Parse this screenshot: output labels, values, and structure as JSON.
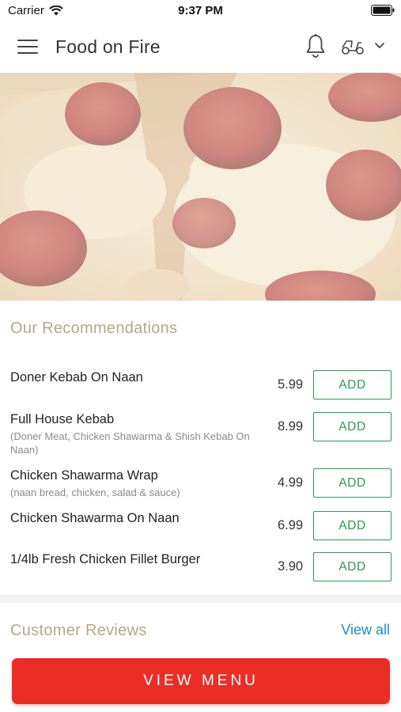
{
  "status_bar": {
    "carrier": "Carrier",
    "time": "9:37 PM"
  },
  "header": {
    "title": "Food on Fire"
  },
  "recommendations": {
    "title": "Our Recommendations",
    "add_label": "ADD",
    "items": [
      {
        "name": "Doner Kebab On Naan",
        "description": "",
        "price": "5.99"
      },
      {
        "name": "Full House Kebab",
        "description": "(Doner Meat, Chicken Shawarma & Shish Kebab On Naan)",
        "price": "8.99"
      },
      {
        "name": "Chicken Shawarma Wrap",
        "description": "(naan bread, chicken, salad & sauce)",
        "price": "4.99"
      },
      {
        "name": "Chicken Shawarma On Naan",
        "description": "",
        "price": "6.99"
      },
      {
        "name": "1/4lb Fresh Chicken Fillet Burger",
        "description": "",
        "price": "3.90"
      }
    ]
  },
  "reviews": {
    "title": "Customer Reviews",
    "view_all_label": "View all"
  },
  "cta": {
    "view_menu_label": "VIEW MENU"
  },
  "colors": {
    "accent_red": "#ea2d27",
    "add_green": "#2e9a50",
    "section_title": "#b7a68a",
    "link_blue": "#1d8ccc"
  }
}
